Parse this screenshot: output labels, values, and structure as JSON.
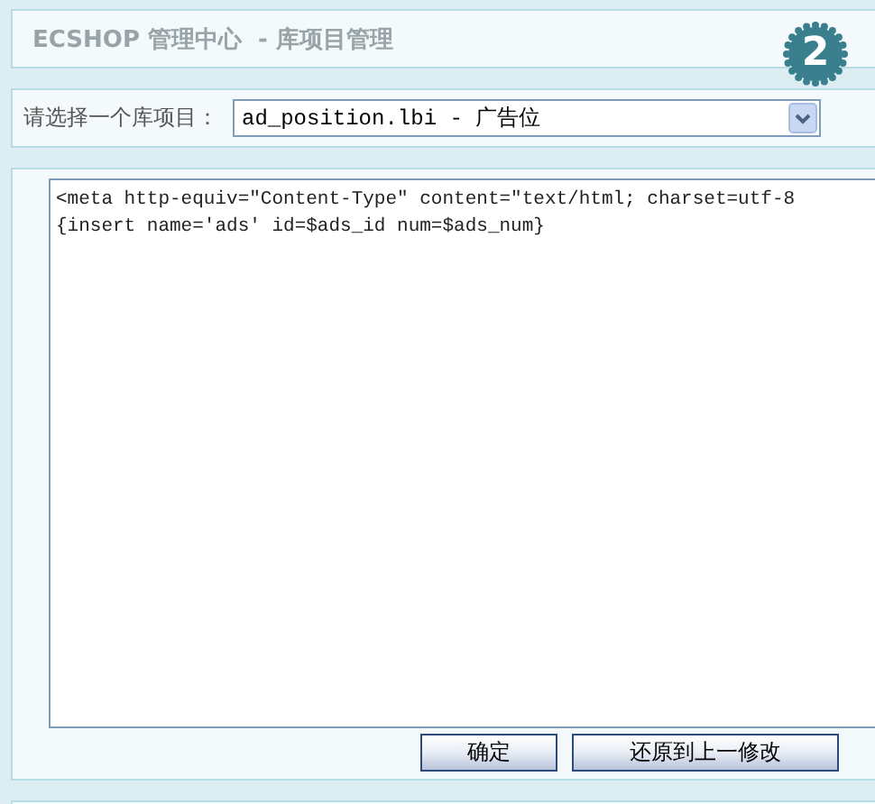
{
  "header": {
    "title": "ECSHOP 管理中心  - 库项目管理",
    "step": "2"
  },
  "library_select": {
    "label": "请选择一个库项目：",
    "value": "ad_position.lbi - 广告位"
  },
  "editor": {
    "lines": [
      "<meta http-equiv=\"Content-Type\" content=\"text/html; charset=utf-8",
      "{insert name='ads' id=$ads_id num=$ads_num}"
    ]
  },
  "buttons": [
    "确定",
    "还原到上一修改"
  ]
}
